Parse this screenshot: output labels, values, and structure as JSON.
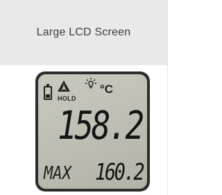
{
  "header": {
    "title": "Large LCD Screen"
  },
  "lcd": {
    "hold_label": "HOLD",
    "unit": "°C",
    "reading": "158.2",
    "max_label": "MAX",
    "max_value": "160.2",
    "icons": [
      "battery-icon",
      "laser-warning-icon",
      "backlight-icon"
    ]
  },
  "colors": {
    "header_bg": "#e9e9e9",
    "lcd_bezel": "#2c2c2c",
    "lcd_screen": "#c2c2b8",
    "segment": "#141414"
  }
}
